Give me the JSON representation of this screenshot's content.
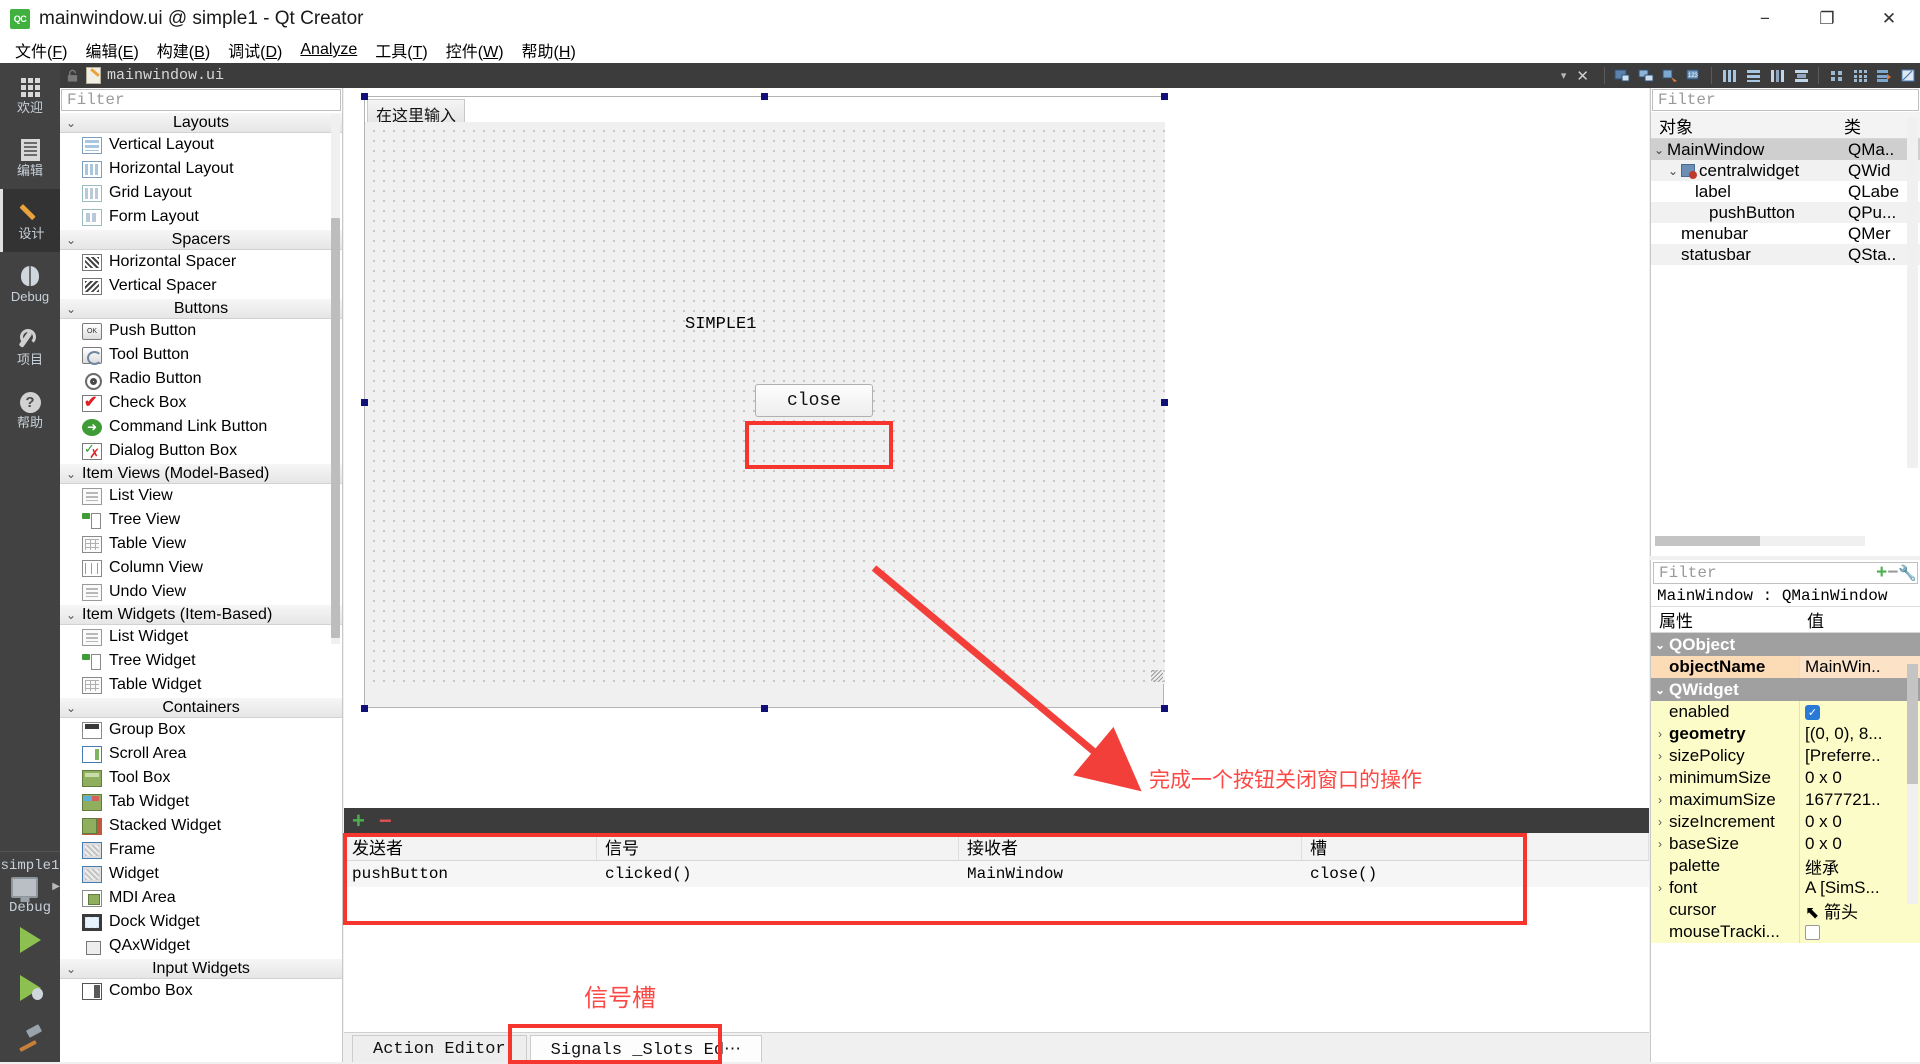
{
  "window": {
    "title": "mainwindow.ui @ simple1 - Qt Creator",
    "logo": "qt-creator-logo",
    "minimize": "−",
    "maximize": "❐",
    "close": "✕"
  },
  "menubar": {
    "items": [
      {
        "label": "文件(F)",
        "name": "menu-file"
      },
      {
        "label": "编辑(E)",
        "name": "menu-edit"
      },
      {
        "label": "构建(B)",
        "name": "menu-build"
      },
      {
        "label": "调试(D)",
        "name": "menu-debug"
      },
      {
        "label": "Analyze",
        "name": "menu-analyze"
      },
      {
        "label": "工具(T)",
        "name": "menu-tools"
      },
      {
        "label": "控件(W)",
        "name": "menu-window"
      },
      {
        "label": "帮助(H)",
        "name": "menu-help"
      }
    ]
  },
  "modebar": {
    "items": [
      {
        "label": "欢迎",
        "icon": "grid-icon",
        "active": false
      },
      {
        "label": "编辑",
        "icon": "document-icon",
        "active": false
      },
      {
        "label": "设计",
        "icon": "pencil-icon",
        "active": true
      },
      {
        "label": "Debug",
        "icon": "bug-icon",
        "active": false
      },
      {
        "label": "项目",
        "icon": "wrench-icon",
        "active": false
      },
      {
        "label": "帮助",
        "icon": "question-icon",
        "active": false
      }
    ],
    "kit": "simple1",
    "build_config": "Debug"
  },
  "editor_toolbar": {
    "filename": "mainwindow.ui",
    "dropdown_caret": "▾",
    "close_label": "✕",
    "buttons": [
      "edit-widgets-icon",
      "edit-signals-slots-icon",
      "edit-buddies-icon",
      "edit-tab-order-icon",
      "layout-horizontal-icon",
      "layout-vertical-icon",
      "layout-splitter-h-icon",
      "layout-splitter-v-icon",
      "layout-form-icon",
      "layout-grid-icon",
      "break-layout-icon",
      "adjust-size-icon"
    ]
  },
  "widgetbox": {
    "filter_placeholder": "Filter",
    "groups": [
      {
        "title": "Layouts",
        "name": "widgetbox-group-layouts",
        "items": [
          {
            "label": "Vertical Layout",
            "icon": "vertical-layout-icon",
            "cls": "ic-vlayout"
          },
          {
            "label": "Horizontal Layout",
            "icon": "horizontal-layout-icon",
            "cls": "ic-hlayout"
          },
          {
            "label": "Grid Layout",
            "icon": "grid-layout-icon",
            "cls": "ic-grid"
          },
          {
            "label": "Form Layout",
            "icon": "form-layout-icon",
            "cls": "ic-form"
          }
        ]
      },
      {
        "title": "Spacers",
        "name": "widgetbox-group-spacers",
        "items": [
          {
            "label": "Horizontal Spacer",
            "icon": "horizontal-spacer-icon",
            "cls": "ic-hspacer"
          },
          {
            "label": "Vertical Spacer",
            "icon": "vertical-spacer-icon",
            "cls": "ic-vspacer"
          }
        ]
      },
      {
        "title": "Buttons",
        "name": "widgetbox-group-buttons",
        "items": [
          {
            "label": "Push Button",
            "icon": "push-button-icon",
            "cls": "ic-push",
            "glyph": "OK"
          },
          {
            "label": "Tool Button",
            "icon": "tool-button-icon",
            "cls": "ic-tool"
          },
          {
            "label": "Radio Button",
            "icon": "radio-button-icon",
            "cls": "ic-radio"
          },
          {
            "label": "Check Box",
            "icon": "check-box-icon",
            "cls": "ic-check"
          },
          {
            "label": "Command Link Button",
            "icon": "command-link-button-icon",
            "cls": "ic-cmdlink",
            "glyph": "➜"
          },
          {
            "label": "Dialog Button Box",
            "icon": "dialog-button-box-icon",
            "cls": "ic-dlgbtn"
          }
        ]
      },
      {
        "title": "Item Views (Model-Based)",
        "name": "widgetbox-group-item-views",
        "align": "left",
        "items": [
          {
            "label": "List View",
            "icon": "list-view-icon",
            "cls": "ic-listview"
          },
          {
            "label": "Tree View",
            "icon": "tree-view-icon",
            "cls": "ic-treeview"
          },
          {
            "label": "Table View",
            "icon": "table-view-icon",
            "cls": "ic-tableview"
          },
          {
            "label": "Column View",
            "icon": "column-view-icon",
            "cls": "ic-colview"
          },
          {
            "label": "Undo View",
            "icon": "undo-view-icon",
            "cls": "ic-listview"
          }
        ]
      },
      {
        "title": "Item Widgets (Item-Based)",
        "name": "widgetbox-group-item-widgets",
        "align": "left",
        "items": [
          {
            "label": "List Widget",
            "icon": "list-widget-icon",
            "cls": "ic-listview"
          },
          {
            "label": "Tree Widget",
            "icon": "tree-widget-icon",
            "cls": "ic-treeview"
          },
          {
            "label": "Table Widget",
            "icon": "table-widget-icon",
            "cls": "ic-tableview"
          }
        ]
      },
      {
        "title": "Containers",
        "name": "widgetbox-group-containers",
        "items": [
          {
            "label": "Group Box",
            "icon": "group-box-icon",
            "cls": "ic-groupbox"
          },
          {
            "label": "Scroll Area",
            "icon": "scroll-area-icon",
            "cls": "ic-scroll"
          },
          {
            "label": "Tool Box",
            "icon": "tool-box-icon",
            "cls": "ic-toolbox"
          },
          {
            "label": "Tab Widget",
            "icon": "tab-widget-icon",
            "cls": "ic-tabw"
          },
          {
            "label": "Stacked Widget",
            "icon": "stacked-widget-icon",
            "cls": "ic-stacked"
          },
          {
            "label": "Frame",
            "icon": "frame-icon",
            "cls": "ic-frame"
          },
          {
            "label": "Widget",
            "icon": "widget-icon",
            "cls": "ic-frame"
          },
          {
            "label": "MDI Area",
            "icon": "mdi-area-icon",
            "cls": "ic-mdi"
          },
          {
            "label": "Dock Widget",
            "icon": "dock-widget-icon",
            "cls": "ic-dock"
          },
          {
            "label": "QAxWidget",
            "icon": "qax-widget-icon",
            "cls": "ic-qax"
          }
        ]
      },
      {
        "title": "Input Widgets",
        "name": "widgetbox-group-input-widgets",
        "items": [
          {
            "label": "Combo Box",
            "icon": "combo-box-icon",
            "cls": "ic-combo"
          }
        ]
      }
    ]
  },
  "form": {
    "menu_placeholder": "在这里输入",
    "label_text": "SIMPLE1",
    "button_text": "close"
  },
  "annotations": {
    "arrow_caption": "完成一个按钮关闭窗口的操作",
    "signal_slot_caption": "信号槽",
    "color": "#fb4a45",
    "box_color": "#f6352f"
  },
  "signal_slot_editor": {
    "add_label": "+",
    "remove_label": "−",
    "sort_caret": "︿",
    "columns": [
      "发送者",
      "信号",
      "接收者",
      "槽"
    ],
    "rows": [
      {
        "sender": "pushButton",
        "signal": "clicked()",
        "receiver": "MainWindow",
        "slot": "close()"
      }
    ],
    "tabs": [
      {
        "label": "Action Editor",
        "active": false
      },
      {
        "label": "Signals _Slots Ed⋯",
        "active": true
      }
    ]
  },
  "object_inspector": {
    "filter_placeholder": "Filter",
    "columns": [
      "对象",
      "类"
    ],
    "rows": [
      {
        "name": "MainWindow",
        "cls": "QMa..",
        "indent": 0,
        "chevron": "⌄",
        "selected": true,
        "icon": ""
      },
      {
        "name": "centralwidget",
        "cls": "QWid",
        "indent": 1,
        "chevron": "⌄",
        "selected": false,
        "icon": "central-widget-icon"
      },
      {
        "name": "label",
        "cls": "QLabe",
        "indent": 2,
        "chevron": "",
        "selected": false,
        "icon": ""
      },
      {
        "name": "pushButton",
        "cls": "QPu...",
        "indent": 3,
        "chevron": "",
        "selected": false,
        "icon": ""
      },
      {
        "name": "menubar",
        "cls": "QMer",
        "indent": 1,
        "chevron": "",
        "selected": false,
        "icon": ""
      },
      {
        "name": "statusbar",
        "cls": "QSta..",
        "indent": 1,
        "chevron": "",
        "selected": false,
        "icon": ""
      }
    ]
  },
  "property_editor": {
    "filter_placeholder": "Filter",
    "object_line": "MainWindow : QMainWindow",
    "add_label": "+",
    "remove_label": "−",
    "config_label": "configure-icon",
    "columns": [
      "属性",
      "值"
    ],
    "rows": [
      {
        "kind": "group",
        "name": "QObject",
        "chevron": "⌄"
      },
      {
        "kind": "prop",
        "name": "objectName",
        "value": "MainWin..",
        "arrow": "",
        "highlight": true
      },
      {
        "kind": "group",
        "name": "QWidget",
        "chevron": "⌄"
      },
      {
        "kind": "prop",
        "name": "enabled",
        "value": "",
        "arrow": "",
        "control": "checkbox-on"
      },
      {
        "kind": "prop",
        "name": "geometry",
        "value": "[(0, 0), 8...",
        "arrow": "›",
        "bold": true
      },
      {
        "kind": "prop",
        "name": "sizePolicy",
        "value": "[Preferre..",
        "arrow": "›"
      },
      {
        "kind": "prop",
        "name": "minimumSize",
        "value": "0 x 0",
        "arrow": "›"
      },
      {
        "kind": "prop",
        "name": "maximumSize",
        "value": "1677721..",
        "arrow": "›"
      },
      {
        "kind": "prop",
        "name": "sizeIncrement",
        "value": "0 x 0",
        "arrow": "›"
      },
      {
        "kind": "prop",
        "name": "baseSize",
        "value": "0 x 0",
        "arrow": "›"
      },
      {
        "kind": "prop",
        "name": "palette",
        "value": "继承",
        "arrow": ""
      },
      {
        "kind": "prop",
        "name": "font",
        "value": "A  [SimS...",
        "arrow": "›"
      },
      {
        "kind": "prop",
        "name": "cursor",
        "value": "⬉ 箭头",
        "arrow": ""
      },
      {
        "kind": "prop",
        "name": "mouseTracki...",
        "value": "",
        "arrow": "",
        "control": "checkbox-off"
      }
    ]
  }
}
